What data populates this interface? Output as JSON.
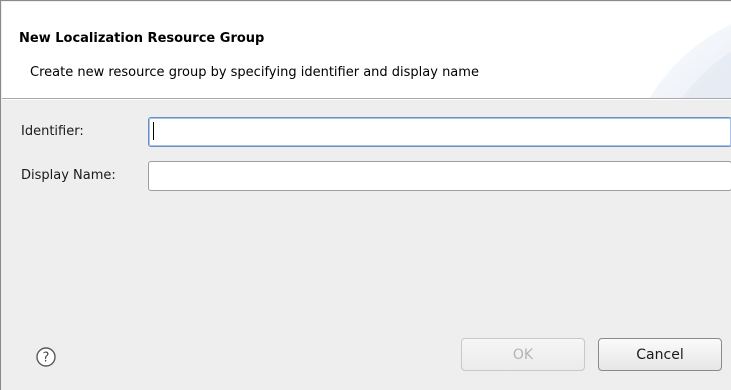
{
  "dialog": {
    "title": "New Localization Resource Group",
    "description": "Create new resource group by specifying identifier and display name"
  },
  "form": {
    "identifier_label": "Identifier:",
    "identifier_value": "",
    "display_name_label": "Display Name:",
    "display_name_value": ""
  },
  "buttons": {
    "ok_label": "OK",
    "ok_enabled": false,
    "cancel_label": "Cancel"
  },
  "icons": {
    "help": "help-icon"
  }
}
